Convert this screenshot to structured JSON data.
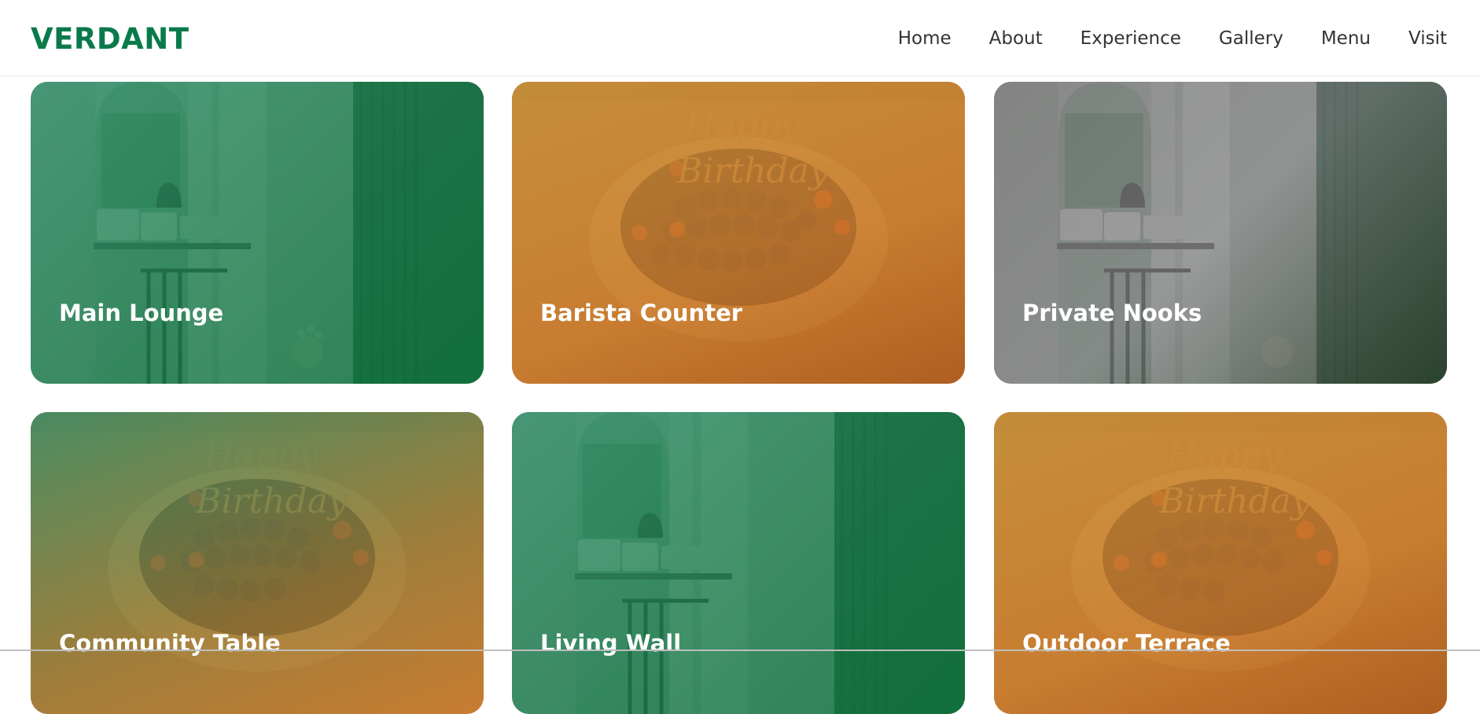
{
  "header": {
    "logo": "VERDANT",
    "nav": [
      "Home",
      "About",
      "Experience",
      "Gallery",
      "Menu",
      "Visit"
    ]
  },
  "gallery": {
    "cards": [
      {
        "title": "Main Lounge",
        "photo": "dining-room",
        "tint": "green"
      },
      {
        "title": "Barista Counter",
        "photo": "birthday-cake",
        "tint": "orange"
      },
      {
        "title": "Private Nooks",
        "photo": "dining-room",
        "tint": "gray"
      },
      {
        "title": "Community Table",
        "photo": "birthday-cake",
        "tint": "green-orange"
      },
      {
        "title": "Living Wall",
        "photo": "dining-room",
        "tint": "green"
      },
      {
        "title": "Outdoor Terrace",
        "photo": "birthday-cake",
        "tint": "orange"
      }
    ]
  },
  "colors": {
    "brand": "#0b7a4b",
    "nav_text": "#333333",
    "card_title": "#ffffff"
  }
}
